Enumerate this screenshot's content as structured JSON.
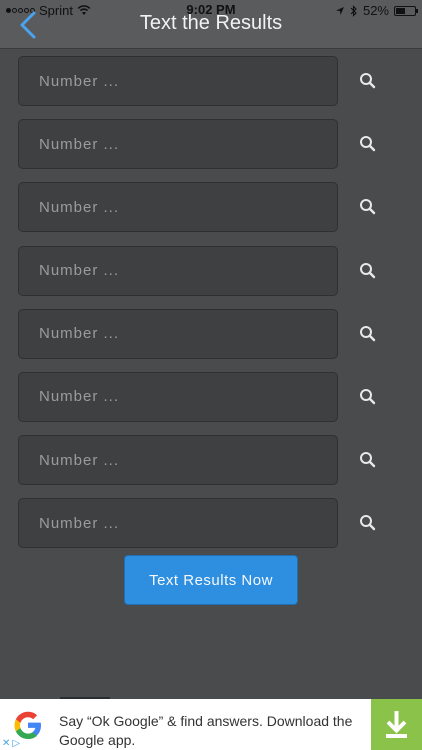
{
  "status_bar": {
    "carrier": "Sprint",
    "time": "9:02 PM",
    "battery_percent": "52%",
    "battery_level": 0.52,
    "signal_bars_filled": 1,
    "signal_bars_total": 5
  },
  "header": {
    "title": "Text the Results",
    "back_icon": "chevron-left-icon"
  },
  "number_rows": [
    {
      "placeholder": "Number ...",
      "value": ""
    },
    {
      "placeholder": "Number ...",
      "value": ""
    },
    {
      "placeholder": "Number ...",
      "value": ""
    },
    {
      "placeholder": "Number ...",
      "value": ""
    },
    {
      "placeholder": "Number ...",
      "value": ""
    },
    {
      "placeholder": "Number ...",
      "value": ""
    },
    {
      "placeholder": "Number ...",
      "value": ""
    },
    {
      "placeholder": "Number ...",
      "value": ""
    }
  ],
  "search_icon": "search-icon",
  "submit_button": {
    "label": "Text Results Now"
  },
  "ad": {
    "text": "Say “Ok Google” & find answers. Download the Google app.",
    "logo_icon": "google-logo",
    "download_icon": "download-icon"
  },
  "colors": {
    "background": "#4a4b4d",
    "header": "#5a5b5d",
    "input_bg": "#3f4042",
    "accent": "#2e8fe0",
    "back_arrow": "#4aa3f0",
    "ad_download": "#8bc34a"
  }
}
